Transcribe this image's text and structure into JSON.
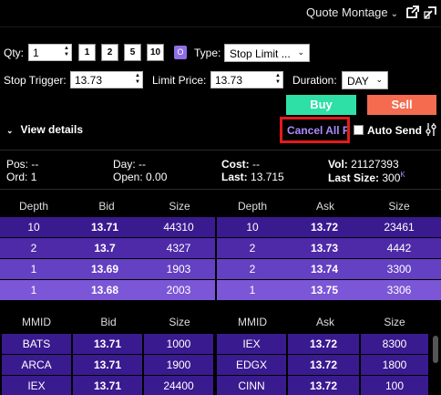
{
  "header": {
    "title": "Quote Montage",
    "icons": [
      "popout-icon",
      "share-icon"
    ]
  },
  "order": {
    "qty_label": "Qty:",
    "qty_value": "1",
    "qty_presets": [
      "1",
      "2",
      "5",
      "10"
    ],
    "o_label": "O",
    "type_label": "Type:",
    "type_value": "Stop Limit ...",
    "stop_trigger_label": "Stop Trigger:",
    "stop_trigger_value": "13.73",
    "limit_price_label": "Limit Price:",
    "limit_price_value": "13.73",
    "duration_label": "Duration:",
    "duration_value": "DAY",
    "buy_label": "Buy",
    "sell_label": "Sell",
    "view_details_label": "View details",
    "cancel_all_label": "Cancel All F",
    "auto_send_label": "Auto Send"
  },
  "stats": {
    "pos_label": "Pos:",
    "pos_value": "--",
    "ord_label": "Ord:",
    "ord_value": "1",
    "day_label": "Day:",
    "day_value": "--",
    "open_label": "Open:",
    "open_value": "0.00",
    "cost_label": "Cost:",
    "cost_value": "--",
    "last_label": "Last:",
    "last_value": "13.715",
    "vol_label": "Vol:",
    "vol_value": "21127393",
    "last_size_label": "Last Size:",
    "last_size_value": "300",
    "last_size_sup": "K"
  },
  "depth_table": {
    "headers": [
      "Depth",
      "Bid",
      "Size",
      "Depth",
      "Ask",
      "Size"
    ],
    "rows": [
      {
        "bid_depth": "10",
        "bid": "13.71",
        "bid_size": "44310",
        "ask_depth": "10",
        "ask": "13.72",
        "ask_size": "23461"
      },
      {
        "bid_depth": "2",
        "bid": "13.7",
        "bid_size": "4327",
        "ask_depth": "2",
        "ask": "13.73",
        "ask_size": "4442"
      },
      {
        "bid_depth": "1",
        "bid": "13.69",
        "bid_size": "1903",
        "ask_depth": "2",
        "ask": "13.74",
        "ask_size": "3300"
      },
      {
        "bid_depth": "1",
        "bid": "13.68",
        "bid_size": "2003",
        "ask_depth": "1",
        "ask": "13.75",
        "ask_size": "3306"
      }
    ]
  },
  "mmid_table": {
    "headers": [
      "MMID",
      "Bid",
      "Size",
      "MMID",
      "Ask",
      "Size"
    ],
    "rows": [
      {
        "bid_mmid": "BATS",
        "bid": "13.71",
        "bid_size": "1000",
        "ask_mmid": "IEX",
        "ask": "13.72",
        "ask_size": "8300"
      },
      {
        "bid_mmid": "ARCA",
        "bid": "13.71",
        "bid_size": "1900",
        "ask_mmid": "EDGX",
        "ask": "13.72",
        "ask_size": "1800"
      },
      {
        "bid_mmid": "IEX",
        "bid": "13.71",
        "bid_size": "24400",
        "ask_mmid": "CINN",
        "ask": "13.72",
        "ask_size": "100"
      }
    ]
  },
  "colors": {
    "buy": "#2fe0a6",
    "sell": "#f46b4f",
    "depth_row_1": "#3a1a8f",
    "depth_row_2": "#4f2aa8",
    "depth_row_3": "#6440c2",
    "depth_row_4": "#7b56d6",
    "mmid_row": "#3a1a8f",
    "cancel_text": "#a98bff",
    "highlight_border": "#e21b1b"
  }
}
